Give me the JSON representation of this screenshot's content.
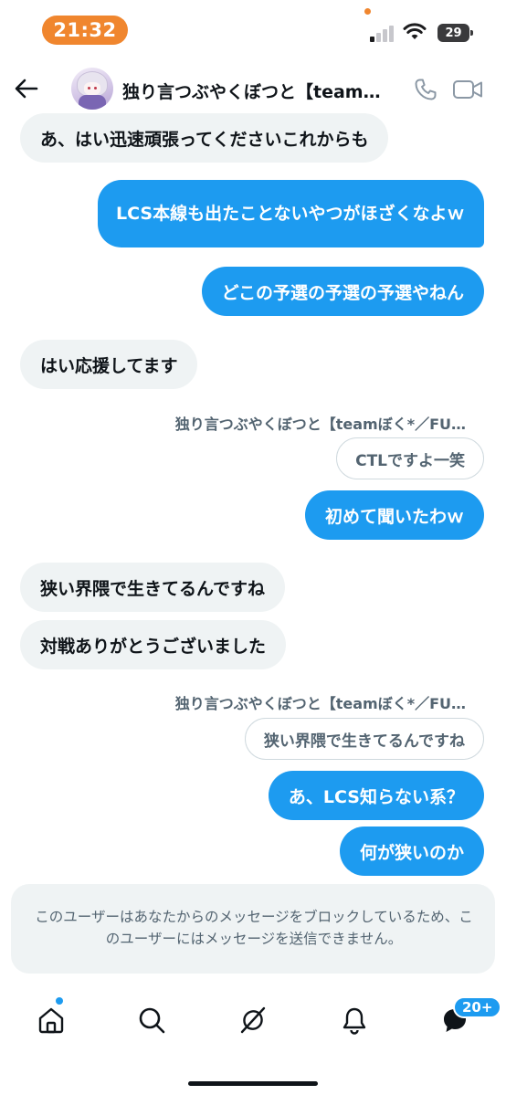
{
  "status_bar": {
    "time": "21:32",
    "battery": "29",
    "accent_color": "#f0862e"
  },
  "header": {
    "title": "独り言つぶやくぼつと【team…",
    "back_icon": "arrow-left-icon",
    "call_icon": "phone-icon",
    "video_icon": "video-icon"
  },
  "messages": [
    {
      "side": "received",
      "text": "あ、はい迅速頑張ってくださいこれからも"
    },
    {
      "side": "sent",
      "text": "LCS本線も出たことないやつがほざくなよｗ"
    },
    {
      "side": "sent",
      "text": "どこの予選の予選の予選やねん"
    },
    {
      "side": "received",
      "text": "はい応援してます"
    },
    {
      "side": "sent",
      "reply_to_name": "独り言つぶやくぼつと【teamぼく*／FU…",
      "reply_to_text": "CTLですよ一笑",
      "text": "初めて聞いたわｗ"
    },
    {
      "side": "received",
      "text": "狭い界隈で生きてるんですね"
    },
    {
      "side": "received",
      "text": "対戦ありがとうございました"
    },
    {
      "side": "sent",
      "reply_to_name": "独り言つぶやくぼつと【teamぼく*／FU…",
      "reply_to_text": "狭い界隈で生きてるんですね",
      "text": "あ、LCS知らない系？"
    },
    {
      "side": "sent",
      "text": "何が狭いのか"
    }
  ],
  "blocked_notice": "このユーザーはあなたからのメッセージをブロックしているため、このユーザーにはメッセージを送信できません。",
  "bottom_nav": {
    "items": [
      "home-icon",
      "search-icon",
      "grok-icon",
      "notifications-icon",
      "messages-icon"
    ],
    "messages_badge": "20+"
  },
  "colors": {
    "sent_bubble": "#1d9bf0",
    "received_bubble": "#eff3f4",
    "text": "#0f1419",
    "secondary_text": "#536471"
  }
}
